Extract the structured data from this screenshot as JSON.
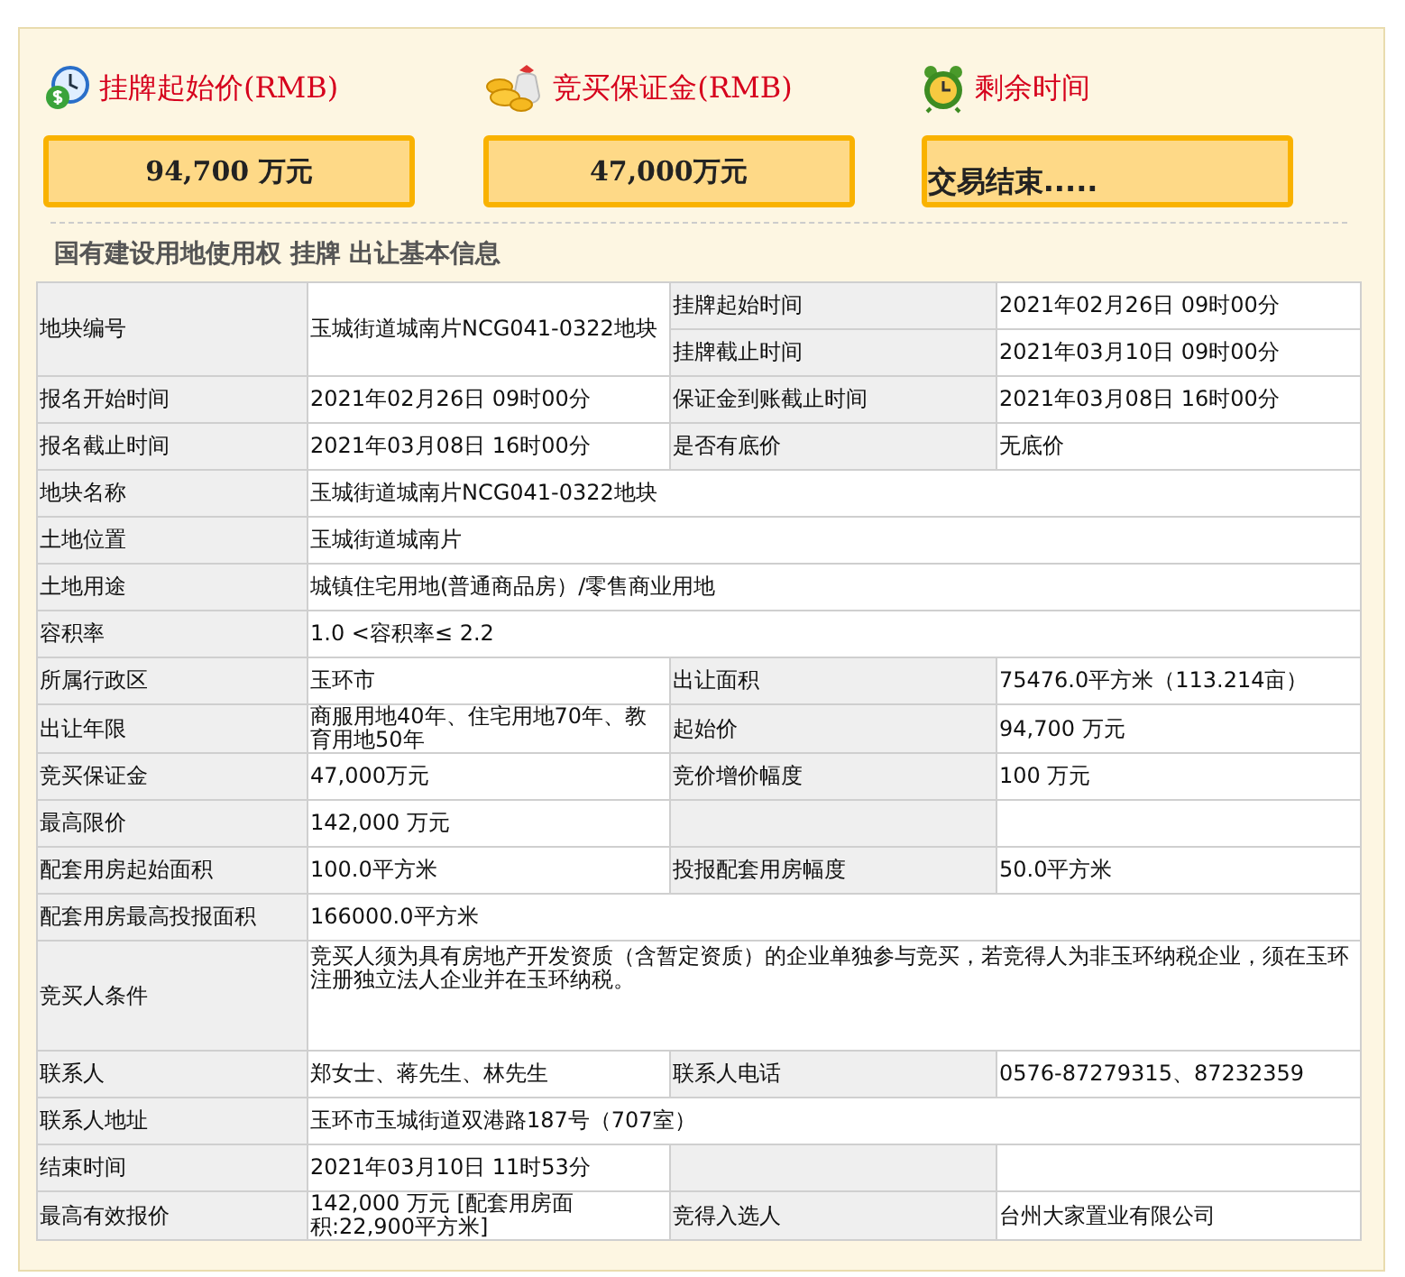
{
  "summary": [
    {
      "kind": "price",
      "title": "挂牌起始价(RMB)",
      "value": "94,700 万元"
    },
    {
      "kind": "deposit",
      "title": "竞买保证金(RMB)",
      "value": "47,000万元"
    },
    {
      "kind": "time",
      "title": "剩余时间",
      "value": "交易结束....."
    }
  ],
  "section_title": "国有建设用地使用权 挂牌 出让基本信息",
  "rows": [
    {
      "label": "地块编号",
      "value": "玉城街道城南片NCG041-0322地块",
      "pairs": [
        {
          "label": "挂牌起始时间",
          "value": "2021年02月26日 09时00分"
        },
        {
          "label": "挂牌截止时间",
          "value": "2021年03月10日 09时00分"
        }
      ]
    },
    {
      "label": "报名开始时间",
      "value": "2021年02月26日 09时00分",
      "pairs": [
        {
          "label": "保证金到账截止时间",
          "value": "2021年03月08日 16时00分"
        }
      ]
    },
    {
      "label": "报名截止时间",
      "value": "2021年03月08日 16时00分",
      "pairs": [
        {
          "label": "是否有底价",
          "value": "无底价"
        }
      ]
    },
    {
      "label": "地块名称",
      "value": "玉城街道城南片NCG041-0322地块"
    },
    {
      "label": "土地位置",
      "value": "玉城街道城南片"
    },
    {
      "label": "土地用途",
      "value": "城镇住宅用地(普通商品房）/零售商业用地"
    },
    {
      "label": "容积率",
      "value": "1.0 <容积率≤ 2.2"
    },
    {
      "label": "所属行政区",
      "value": "玉环市",
      "pairs": [
        {
          "label": "出让面积",
          "value": "75476.0平方米（113.214亩）"
        }
      ]
    },
    {
      "label": "出让年限",
      "value": "商服用地40年、住宅用地70年、教育用地50年",
      "pairs": [
        {
          "label": "起始价",
          "value": "94,700 万元"
        }
      ]
    },
    {
      "label": "竞买保证金",
      "value": "47,000万元",
      "pairs": [
        {
          "label": "竞价增价幅度",
          "value": "100 万元"
        }
      ]
    },
    {
      "kind": "half",
      "label": "最高限价",
      "value": "142,000 万元"
    },
    {
      "label": "配套用房起始面积",
      "value": "100.0平方米",
      "pairs": [
        {
          "label": "投报配套用房幅度",
          "value": "50.0平方米"
        }
      ]
    },
    {
      "label": "配套用房最高投报面积",
      "value": "166000.0平方米"
    },
    {
      "kind": "note",
      "label": "竞买人条件",
      "value": "竞买人须为具有房地产开发资质（含暂定资质）的企业单独参与竞买，若竞得人为非玉环纳税企业，须在玉环注册独立法人企业并在玉环纳税。"
    },
    {
      "label": "联系人",
      "value": "郑女士、蒋先生、林先生",
      "pairs": [
        {
          "label": "联系人电话",
          "value": "0576-87279315、87232359"
        }
      ]
    },
    {
      "label": "联系人地址",
      "value": "玉环市玉城街道双港路187号（707室）"
    },
    {
      "kind": "half",
      "label": "结束时间",
      "value": "2021年03月10日 11时53分"
    },
    {
      "label": "最高有效报价",
      "value": "142,000 万元 [配套用房面积:22,900平方米]",
      "pairs": [
        {
          "label": "竞得入选人",
          "value": "台州大家置业有限公司"
        }
      ]
    }
  ]
}
